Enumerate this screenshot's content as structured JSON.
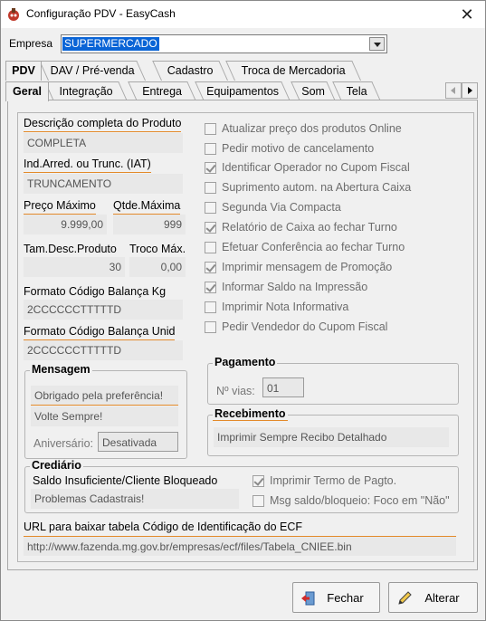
{
  "window": {
    "title": "Configuração PDV - EasyCash"
  },
  "empresa": {
    "label": "Empresa",
    "value": "SUPERMERCADO"
  },
  "top_tabs": [
    "PDV",
    "DAV / Pré-venda",
    "Cadastro",
    "Troca de Mercadoria"
  ],
  "sub_tabs": [
    "Geral",
    "Integração",
    "Entrega",
    "Equipamentos",
    "Som",
    "Tela"
  ],
  "fields": {
    "descricao_label": "Descrição completa do Produto",
    "descricao_value": "COMPLETA",
    "iat_label": "Ind.Arred. ou Trunc. (IAT)",
    "iat_value": "TRUNCAMENTO",
    "preco_max_label": "Preço Máximo",
    "preco_max_value": "9.999,00",
    "qtde_max_label": "Qtde.Máxima",
    "qtde_max_value": "999",
    "tam_desc_label": "Tam.Desc.Produto",
    "tam_desc_value": "30",
    "troco_max_label": "Troco Máx.",
    "troco_max_value": "0,00",
    "fmt_kg_label": "Formato Código Balança Kg",
    "fmt_kg_value": "2CCCCCCTTTTTD",
    "fmt_unid_label": "Formato Código Balança Unid",
    "fmt_unid_value": "2CCCCCCTTTTTD"
  },
  "options": [
    {
      "label": "Atualizar preço dos produtos Online",
      "checked": false
    },
    {
      "label": "Pedir motivo de cancelamento",
      "checked": false
    },
    {
      "label": "Identificar Operador no Cupom Fiscal",
      "checked": true
    },
    {
      "label": "Suprimento autom. na Abertura Caixa",
      "checked": false
    },
    {
      "label": "Segunda Via Compacta",
      "checked": false
    },
    {
      "label": "Relatório de Caixa ao fechar Turno",
      "checked": true
    },
    {
      "label": "Efetuar Conferência ao fechar Turno",
      "checked": false
    },
    {
      "label": "Imprimir mensagem de Promoção",
      "checked": true
    },
    {
      "label": "Informar Saldo na Impressão",
      "checked": true
    },
    {
      "label": "Imprimir Nota Informativa",
      "checked": false
    },
    {
      "label": "Pedir Vendedor do Cupom Fiscal",
      "checked": false
    }
  ],
  "mensagem": {
    "title": "Mensagem",
    "line1": "Obrigado pela preferência!",
    "line2": "Volte Sempre!",
    "aniversario_label": "Aniversário:",
    "aniversario_value": "Desativada"
  },
  "pagamento": {
    "title": "Pagamento",
    "vias_label": "Nº vias:",
    "vias_value": "01"
  },
  "recebimento": {
    "title": "Recebimento",
    "value": "Imprimir Sempre Recibo Detalhado"
  },
  "crediario": {
    "title": "Crediário",
    "saldo_label": "Saldo Insuficiente/Cliente Bloqueado",
    "saldo_value": "Problemas Cadastrais!",
    "opt_termo": "Imprimir Termo de Pagto.",
    "opt_msg": "Msg saldo/bloqueio: Foco em \"Não\""
  },
  "url": {
    "label": "URL para baixar tabela Código de Identificação do ECF",
    "value": "http://www.fazenda.mg.gov.br/empresas/ecf/files/Tabela_CNIEE.bin"
  },
  "buttons": {
    "fechar": "Fechar",
    "alterar": "Alterar"
  }
}
